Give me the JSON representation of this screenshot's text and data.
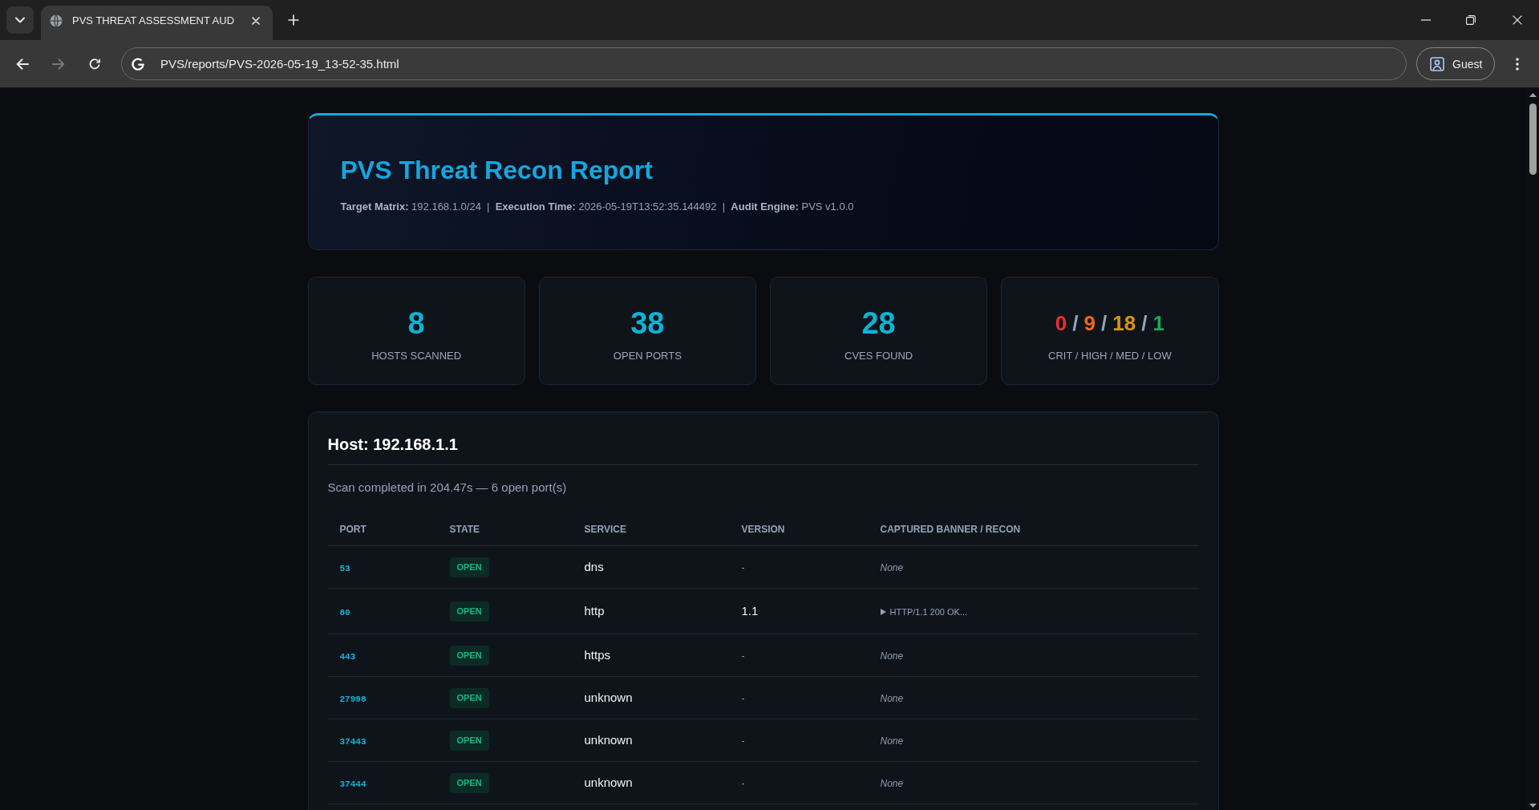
{
  "browser": {
    "tabs": [
      {
        "title": "PVS THREAT ASSESSMENT AUD",
        "selected": true
      }
    ],
    "navigation": [
      {
        "kind": "back",
        "disabled": false
      },
      {
        "kind": "forward",
        "disabled": true
      },
      {
        "kind": "reload",
        "disabled": false
      }
    ],
    "address": "PVS/reports/PVS-2026-05-19_13-52-35.html",
    "profile": "Guest"
  },
  "header": {
    "title": "PVS Threat Recon Report",
    "meta": "**Target Matrix:** 192.168.1.0/24  |  **Execution Time:** 2026-05-19T13:52:35.144492  |  **Audit Engine:** PVS v1.0.0"
  },
  "stats": [
    {
      "kind": "count",
      "value": "8",
      "label": "HOSTS SCANNED"
    },
    {
      "kind": "count",
      "value": "38",
      "label": "OPEN PORTS"
    },
    {
      "kind": "count",
      "value": "28",
      "label": "CVES FOUND"
    },
    {
      "kind": "severity",
      "values": [
        {
          "text": "0",
          "color": "#e8302a"
        },
        {
          "text": "9",
          "color": "#f2661b"
        },
        {
          "text": "18",
          "color": "#d9940c"
        },
        {
          "text": "1",
          "color": "#1ea853"
        }
      ],
      "separators": [
        "/",
        "/",
        "/"
      ],
      "label": "CRIT / HIGH / MED / LOW"
    }
  ],
  "host": {
    "title": "Host: 192.168.1.1",
    "summary": "Scan completed in 204.47s — 6 open port(s)",
    "columns": [
      "PORT",
      "STATE",
      "SERVICE",
      "VERSION",
      "CAPTURED BANNER / RECON"
    ],
    "rows": [
      {
        "port": "53",
        "state": "OPEN",
        "service": "dns",
        "version": {
          "kind": "placeholder",
          "text": "-"
        },
        "banner": {
          "kind": "none",
          "text": "None"
        }
      },
      {
        "port": "80",
        "state": "OPEN",
        "service": "http",
        "version": {
          "kind": "value",
          "text": "1.1"
        },
        "banner": {
          "kind": "details",
          "text": "HTTP/1.1 200 OK...",
          "expanded": false
        }
      },
      {
        "port": "443",
        "state": "OPEN",
        "service": "https",
        "version": {
          "kind": "placeholder",
          "text": "-"
        },
        "banner": {
          "kind": "none",
          "text": "None"
        }
      },
      {
        "port": "27998",
        "state": "OPEN",
        "service": "unknown",
        "version": {
          "kind": "placeholder",
          "text": "-"
        },
        "banner": {
          "kind": "none",
          "text": "None"
        }
      },
      {
        "port": "37443",
        "state": "OPEN",
        "service": "unknown",
        "version": {
          "kind": "placeholder",
          "text": "-"
        },
        "banner": {
          "kind": "none",
          "text": "None"
        }
      },
      {
        "port": "37444",
        "state": "OPEN",
        "service": "unknown",
        "version": {
          "kind": "placeholder",
          "text": "-"
        },
        "banner": {
          "kind": "none",
          "text": "None"
        }
      }
    ]
  }
}
